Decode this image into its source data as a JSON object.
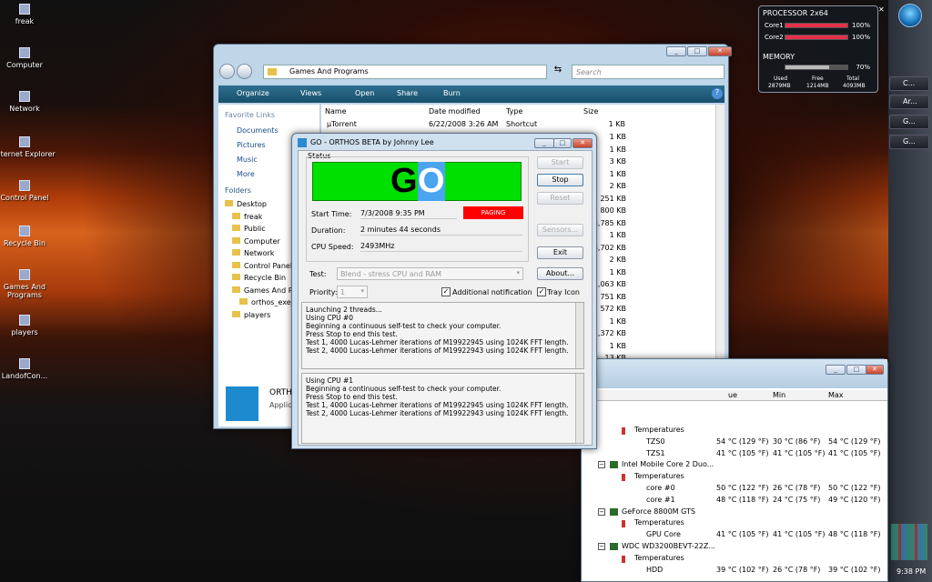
{
  "desktop": {
    "icons": [
      {
        "label": "freak",
        "icon": "folder-icon"
      },
      {
        "label": "Computer",
        "icon": "computer-icon"
      },
      {
        "label": "Network",
        "icon": "network-icon"
      },
      {
        "label": "Internet Explorer",
        "icon": "ie-icon"
      },
      {
        "label": "Control Panel",
        "icon": "control-panel-icon"
      },
      {
        "label": "Recycle Bin",
        "icon": "recycle-bin-icon"
      },
      {
        "label": "Games And Programs",
        "icon": "folder-icon"
      },
      {
        "label": "players",
        "icon": "folder-icon"
      },
      {
        "label": "LandofCon...",
        "icon": "file-icon"
      }
    ]
  },
  "gadget": {
    "processor_title": "PROCESSOR 2x64",
    "core1": "Core1",
    "core1_pct": "100%",
    "core1_value": 1.0,
    "core2": "Core2",
    "core2_pct": "100%",
    "core2_value": 1.0,
    "memory_title": "MEMORY",
    "memory_pct": "70%",
    "memory_value": 0.7,
    "used_label": "Used",
    "free_label": "Free",
    "total_label": "Total",
    "used": "2879MB",
    "free": "1214MB",
    "total": "4093MB"
  },
  "taskbar": {
    "buttons": [
      "C...",
      "Ar...",
      "G...",
      "G..."
    ],
    "time": "9:38 PM"
  },
  "explorer": {
    "path_root": "Games And Programs",
    "search_placeholder": "Search",
    "toolbar": {
      "organize": "Organize",
      "views": "Views",
      "open": "Open",
      "share": "Share",
      "burn": "Burn"
    },
    "favorite_links_title": "Favorite Links",
    "favorites": [
      "Documents",
      "Pictures",
      "Music",
      "More"
    ],
    "folders_title": "Folders",
    "folders": [
      "Desktop",
      "freak",
      "Public",
      "Computer",
      "Network",
      "Control Panel",
      "Recycle Bin",
      "Games And Pr",
      "orthos_exe_",
      "players"
    ],
    "columns": {
      "name": "Name",
      "date": "Date modified",
      "type": "Type",
      "size": "Size"
    },
    "first_row": {
      "name": "µTorrent",
      "date": "6/22/2008 3:26 AM",
      "type": "Shortcut",
      "size": "1 KB"
    },
    "sizes": [
      "1 KB",
      "1 KB",
      "3 KB",
      "1 KB",
      "2 KB",
      "251 KB",
      "800 KB",
      "3,785 KB",
      "1 KB",
      "3,702 KB",
      "2 KB",
      "1 KB",
      "1,063 KB",
      "751 KB",
      "572 KB",
      "1 KB",
      "1,372 KB",
      "1 KB",
      "13 KB"
    ],
    "preview_title": "ORTH",
    "preview_sub": "Applic"
  },
  "orthos": {
    "title": "GO - ORTHOS BETA by Johnny Lee",
    "status_label": "Status",
    "go_g": "G",
    "go_o": "O",
    "start_time_label": "Start Time:",
    "start_time": "7/3/2008 9:35 PM",
    "paging": "PAGING",
    "duration_label": "Duration:",
    "duration": "2 minutes 44 seconds",
    "cpu_speed_label": "CPU Speed:",
    "cpu_speed": "2493MHz",
    "test_label": "Test:",
    "test_value": "Blend - stress CPU and RAM",
    "priority_label": "Priority:",
    "priority_value": "1",
    "additional_notification": "Additional notification",
    "tray_icon": "Tray Icon",
    "buttons": {
      "start": "Start",
      "stop": "Stop",
      "reset": "Reset",
      "sensors": "Sensors...",
      "exit": "Exit",
      "about": "About..."
    },
    "log1": [
      "Launching 2 threads...",
      "Using CPU #0",
      "Beginning a continuous self-test to check your computer.",
      "Press Stop to end this test.",
      "Test 1, 4000 Lucas-Lehmer iterations of M19922945 using 1024K FFT length.",
      "Test 2, 4000 Lucas-Lehmer iterations of M19922943 using 1024K FFT length."
    ],
    "log2": [
      "Using CPU #1",
      "Beginning a continuous self-test to check your computer.",
      "Press Stop to end this test.",
      "Test 1, 4000 Lucas-Lehmer iterations of M19922945 using 1024K FFT length.",
      "Test 2, 4000 Lucas-Lehmer iterations of M19922943 using 1024K FFT length."
    ]
  },
  "hwmon": {
    "columns": {
      "value": "ue",
      "min": "Min",
      "max": "Max"
    },
    "rows": [
      {
        "type": "group",
        "label": "Temperatures",
        "indent": 2
      },
      {
        "type": "sensor",
        "label": "TZS0",
        "value": "54 °C  (129 °F)",
        "min": "30 °C  (86 °F)",
        "max": "54 °C  (129 °F)"
      },
      {
        "type": "sensor",
        "label": "TZS1",
        "value": "41 °C  (105 °F)",
        "min": "41 °C  (105 °F)",
        "max": "41 °C  (105 °F)"
      },
      {
        "type": "device",
        "label": "Intel Mobile Core 2 Duo..."
      },
      {
        "type": "group",
        "label": "Temperatures"
      },
      {
        "type": "sensor",
        "label": "core #0",
        "value": "50 °C  (122 °F)",
        "min": "26 °C  (78 °F)",
        "max": "50 °C  (122 °F)"
      },
      {
        "type": "sensor",
        "label": "core #1",
        "value": "48 °C  (118 °F)",
        "min": "24 °C  (75 °F)",
        "max": "49 °C  (120 °F)"
      },
      {
        "type": "device",
        "label": "GeForce 8800M GTS"
      },
      {
        "type": "group",
        "label": "Temperatures"
      },
      {
        "type": "sensor",
        "label": "GPU Core",
        "value": "41 °C  (105 °F)",
        "min": "41 °C  (105 °F)",
        "max": "48 °C  (118 °F)"
      },
      {
        "type": "device",
        "label": "WDC WD3200BEVT-22Z..."
      },
      {
        "type": "group",
        "label": "Temperatures"
      },
      {
        "type": "sensor",
        "label": "HDD",
        "value": "39 °C  (102 °F)",
        "min": "26 °C  (78 °F)",
        "max": "39 °C  (102 °F)"
      }
    ]
  }
}
